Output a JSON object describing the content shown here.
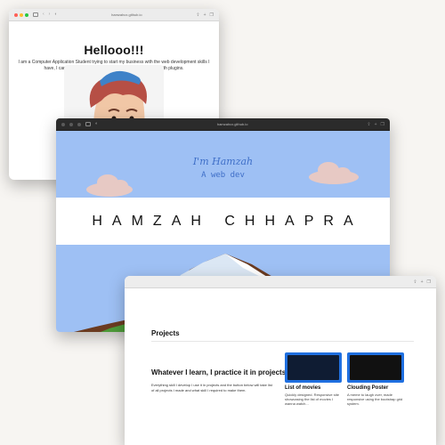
{
  "window1": {
    "url": "hamzahcx.github.io",
    "heading": "Hellooo!!!",
    "intro": "I am a Computer Application Student trying to start my business with the web development skills I have, I can quickly design and customize responsive sites with plugins."
  },
  "window2": {
    "url": "hamzahcx.github.io",
    "hero_name": "I'm Hamzah",
    "hero_role": "A web dev",
    "brand": "HAMZAH CHHAPRA"
  },
  "window3": {
    "section_title": "Projects",
    "tagline": "Whatever I learn, I practice it in projects",
    "description": "Everything skill I develop I use it in projects and the button below will take list of all projects I made and what skill I required to make them.",
    "projects": [
      {
        "title": "List of movies",
        "desc": "Quickly designed. Responsive site showcasing the list of movies I wanna watch..."
      },
      {
        "title": "Clouding Poster",
        "desc": "A meme to laugh over, made responsive using the bootstrap grid system."
      }
    ]
  },
  "colors": {
    "sky": "#9ec0f4",
    "hero_text": "#3f6fc8",
    "card_border": "#1f6fe0"
  }
}
